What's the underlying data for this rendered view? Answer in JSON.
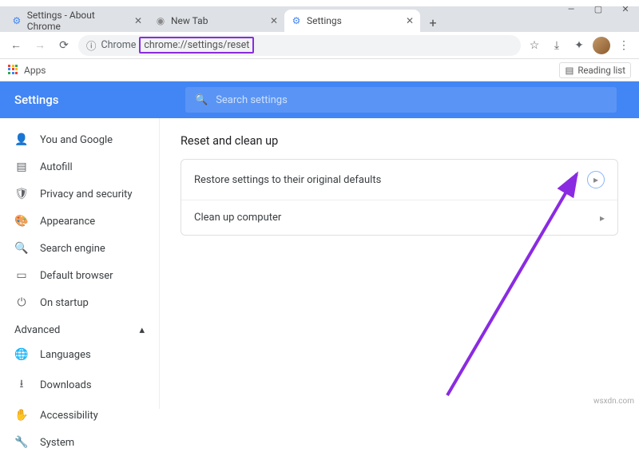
{
  "window": {
    "min": "—",
    "max": "▢",
    "close": "✕"
  },
  "tabs": [
    {
      "label": "Settings - About Chrome",
      "icon": "⚙",
      "iconColor": "#4285f4"
    },
    {
      "label": "New Tab",
      "icon": "◉",
      "iconColor": "#888"
    },
    {
      "label": "Settings",
      "icon": "⚙",
      "iconColor": "#4285f4"
    }
  ],
  "newtab": "+",
  "toolbar": {
    "back": "←",
    "fwd": "→",
    "reload": "⟳",
    "secure_icon": "ⓘ",
    "host_label": "Chrome",
    "url": "chrome://settings/reset",
    "star": "☆",
    "cloud": "⤓",
    "ext": "✦",
    "menu": "⋮"
  },
  "bookmarks": {
    "apps": "Apps",
    "reading_icon": "▤",
    "reading": "Reading list"
  },
  "header": {
    "title": "Settings",
    "search_icon": "🔍",
    "search_placeholder": "Search settings"
  },
  "sidebar": {
    "items": [
      {
        "icon": "👤",
        "label": "You and Google"
      },
      {
        "icon": "▤",
        "label": "Autofill"
      },
      {
        "icon": "🛡",
        "label": "Privacy and security"
      },
      {
        "icon": "🎨",
        "label": "Appearance"
      },
      {
        "icon": "🔍",
        "label": "Search engine"
      },
      {
        "icon": "▭",
        "label": "Default browser"
      },
      {
        "icon": "⏻",
        "label": "On startup"
      }
    ],
    "advanced": "Advanced",
    "advanced_caret": "▴",
    "adv_items": [
      {
        "icon": "🌐",
        "label": "Languages"
      },
      {
        "icon": "⭳",
        "label": "Downloads"
      },
      {
        "icon": "✋",
        "label": "Accessibility"
      },
      {
        "icon": "🔧",
        "label": "System"
      }
    ]
  },
  "main": {
    "section_title": "Reset and clean up",
    "rows": [
      {
        "label": "Restore settings to their original defaults",
        "chev": "▸"
      },
      {
        "label": "Clean up computer",
        "chev": "▸"
      }
    ]
  },
  "watermark": "wsxdn.com"
}
